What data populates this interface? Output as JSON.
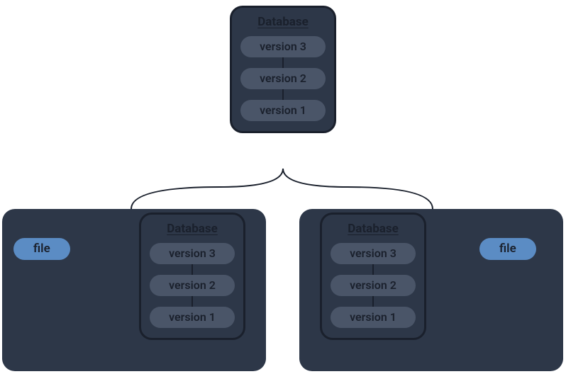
{
  "top": {
    "db_label": "Database",
    "versions": [
      "version 3",
      "version 2",
      "version 1"
    ]
  },
  "left": {
    "db_label": "Database",
    "file_label": "file",
    "versions": [
      "version 3",
      "version 2",
      "version 1"
    ]
  },
  "right": {
    "db_label": "Database",
    "file_label": "file",
    "versions": [
      "version 3",
      "version 2",
      "version 1"
    ]
  }
}
